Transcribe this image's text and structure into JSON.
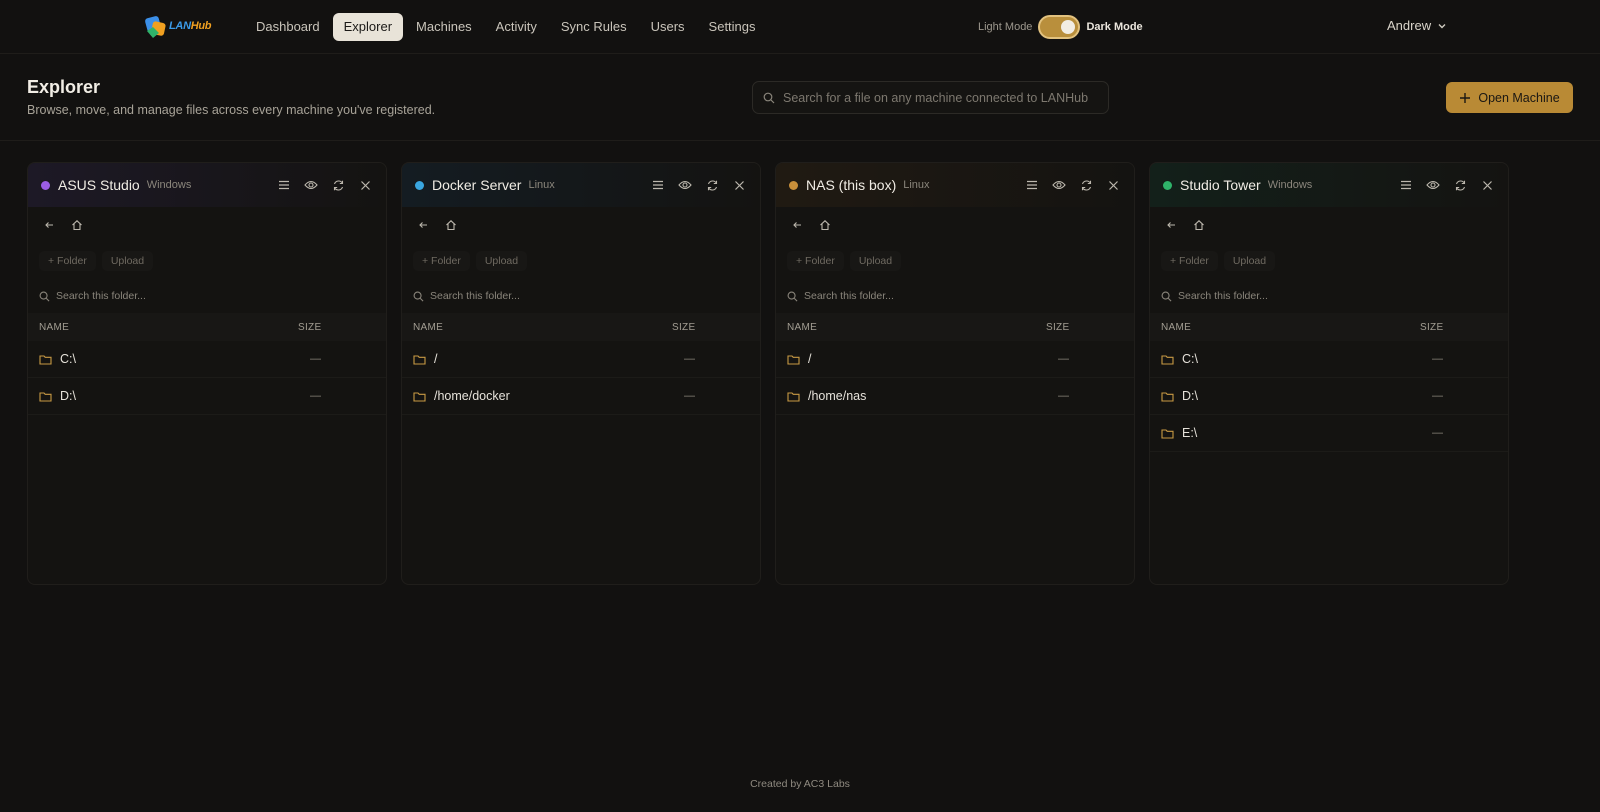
{
  "app": {
    "logo_text_a": "LAN",
    "logo_text_b": "Hub"
  },
  "nav": {
    "items": [
      {
        "label": "Dashboard",
        "active": false
      },
      {
        "label": "Explorer",
        "active": true
      },
      {
        "label": "Machines",
        "active": false
      },
      {
        "label": "Activity",
        "active": false
      },
      {
        "label": "Sync Rules",
        "active": false
      },
      {
        "label": "Users",
        "active": false
      },
      {
        "label": "Settings",
        "active": false
      }
    ]
  },
  "theme": {
    "light_label": "Light Mode",
    "dark_label": "Dark Mode",
    "dark_enabled": true
  },
  "user": {
    "name": "Andrew"
  },
  "header": {
    "title": "Explorer",
    "subtitle": "Browse, move, and manage files across every machine you've registered.",
    "search_placeholder": "Search for a file on any machine connected to LANHub",
    "open_button": "Open Machine"
  },
  "panel_labels": {
    "folder_button": "+ Folder",
    "upload_button": "Upload",
    "search_placeholder": "Search this folder...",
    "col_name": "NAME",
    "col_size": "SIZE"
  },
  "colors": {
    "accent": "#b98a35",
    "background": "#121110"
  },
  "panels": [
    {
      "name": "ASUS Studio",
      "os": "Windows",
      "status_color": "#9b5de5",
      "tint": "#1d1926",
      "rows": [
        {
          "name": "C:\\",
          "size": "—"
        },
        {
          "name": "D:\\",
          "size": "—"
        }
      ]
    },
    {
      "name": "Docker Server",
      "os": "Linux",
      "status_color": "#3aa6e0",
      "tint": "#141c22",
      "rows": [
        {
          "name": "/",
          "size": "—"
        },
        {
          "name": "/home/docker",
          "size": "—"
        }
      ]
    },
    {
      "name": "NAS (this box)",
      "os": "Linux",
      "status_color": "#c88f3a",
      "tint": "#201a12",
      "rows": [
        {
          "name": "/",
          "size": "—"
        },
        {
          "name": "/home/nas",
          "size": "—"
        }
      ]
    },
    {
      "name": "Studio Tower",
      "os": "Windows",
      "status_color": "#2fb36a",
      "tint": "#13201a",
      "rows": [
        {
          "name": "C:\\",
          "size": "—"
        },
        {
          "name": "D:\\",
          "size": "—"
        },
        {
          "name": "E:\\",
          "size": "—"
        }
      ]
    }
  ],
  "footer": {
    "text": "Created by AC3 Labs"
  }
}
